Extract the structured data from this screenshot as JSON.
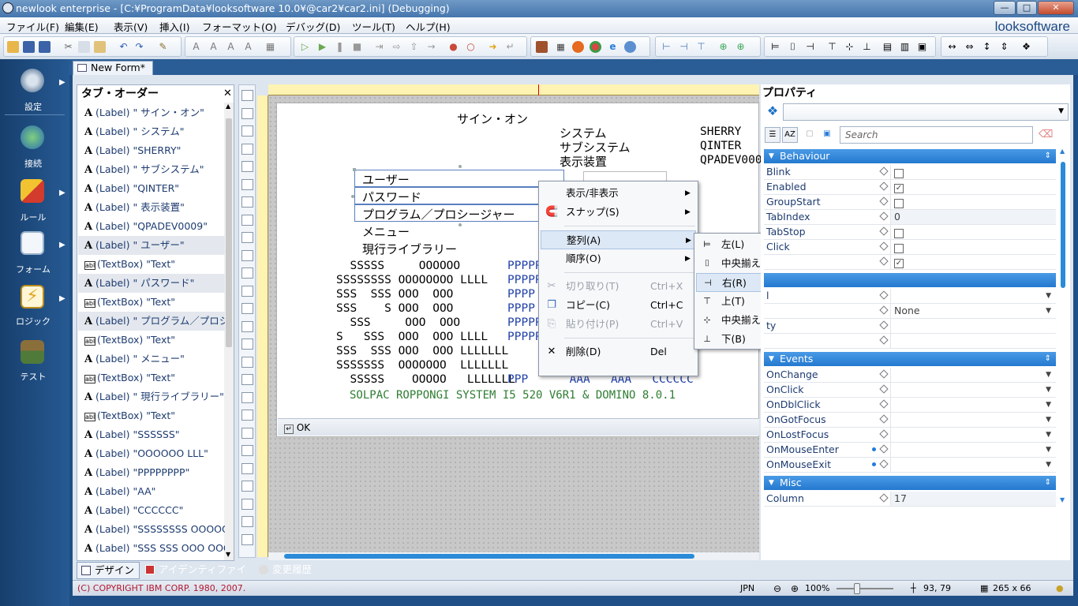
{
  "window": {
    "title": "newlook enterprise - [C:¥ProgramData¥looksoftware 10.0¥@car2¥car2.ini] (Debugging)",
    "brand": "looksoftware"
  },
  "menu": [
    "ファイル(F)",
    "編集(E)",
    "表示(V)",
    "挿入(I)",
    "フォーマット(O)",
    "デバッグ(D)",
    "ツール(T)",
    "ヘルプ(H)"
  ],
  "nav": [
    {
      "label": "設定",
      "icon": "gear-icon"
    },
    {
      "label": "接続",
      "icon": "globe-icon"
    },
    {
      "label": "ルール",
      "icon": "blocks-icon"
    },
    {
      "label": "フォーム",
      "icon": "form-icon"
    },
    {
      "label": "ロジック",
      "icon": "lightning-icon"
    },
    {
      "label": "テスト",
      "icon": "stamp-icon"
    }
  ],
  "doc_tab": "New Form*",
  "taborder": {
    "title": "タブ・オーダー",
    "items": [
      {
        "type": "A",
        "text": "(Label) \"        サイン・オン\""
      },
      {
        "type": "A",
        "text": "(Label) \" システム\""
      },
      {
        "type": "A",
        "text": "(Label) \"SHERRY\""
      },
      {
        "type": "A",
        "text": "(Label) \" サブシステム\""
      },
      {
        "type": "A",
        "text": "(Label) \"QINTER\""
      },
      {
        "type": "A",
        "text": "(Label) \" 表示装置\""
      },
      {
        "type": "A",
        "text": "(Label) \"QPADEV0009\""
      },
      {
        "type": "A",
        "text": "(Label) \" ユーザー\"",
        "hl": true
      },
      {
        "type": "abl",
        "text": "(TextBox) \"Text\""
      },
      {
        "type": "A",
        "text": "(Label) \" パスワード\"",
        "hl": true
      },
      {
        "type": "abl",
        "text": "(TextBox) \"Text\""
      },
      {
        "type": "A",
        "text": "(Label) \" プログラム／プロシージャー\"",
        "hl": true
      },
      {
        "type": "abl",
        "text": "(TextBox) \"Text\""
      },
      {
        "type": "A",
        "text": "(Label) \" メニュー\""
      },
      {
        "type": "abl",
        "text": "(TextBox) \"Text\""
      },
      {
        "type": "A",
        "text": "(Label) \" 現行ライブラリー\""
      },
      {
        "type": "abl",
        "text": "(TextBox) \"Text\""
      },
      {
        "type": "A",
        "text": "(Label) \"SSSSSS\""
      },
      {
        "type": "A",
        "text": "(Label) \"OOOOOO  LLL\""
      },
      {
        "type": "A",
        "text": "(Label) \"PPPPPPPP\""
      },
      {
        "type": "A",
        "text": "(Label) \"AA\""
      },
      {
        "type": "A",
        "text": "(Label) \"CCCCCC\""
      },
      {
        "type": "A",
        "text": "(Label) \"SSSSSSSS OOOOOOOO\""
      },
      {
        "type": "A",
        "text": "(Label) \"SSS  SSS OOO  OOO\""
      }
    ]
  },
  "form": {
    "title": "サイン・オン",
    "sys_labels": [
      "システム",
      "サブシステム",
      "表示装置"
    ],
    "sys_values": [
      "SHERRY",
      "QINTER",
      "QPADEV000"
    ],
    "fields": [
      "ユーザー",
      "パスワード",
      "プログラム／プロシージャー",
      "メニュー",
      "現行ライブラリー"
    ],
    "art_black": [
      "  SSSSS     OOOOOO",
      "SSSSSSSS OOOOOOOO LLLL",
      "SSS  SSS OOO  OOO",
      "SSS    S OOO  OOO",
      "  SSS     OOO  OOO",
      "S   SSS  OOO  OOO LLLL",
      "SSS  SSS OOO  OOO LLLLLLL",
      "SSSSSSS  OOOOOOO  LLLLLLL",
      "  SSSSS    OOOOO   LLLLLLL"
    ],
    "art_blue": [
      "PPPPP",
      "PPPPP",
      "PPPP",
      "PPPP",
      "PPPPP",
      "PPPPP",
      "",
      "",
      "PPP      AAA   AAA   CCCCCC"
    ],
    "footer": "SOLPAC ROPPONGI SYSTEM I5 520 V6R1 & DOMINO 8.0.1",
    "ok": "OK"
  },
  "context_menu": [
    {
      "label": "表示/非表示",
      "arrow": true
    },
    {
      "label": "スナップ(S)",
      "arrow": true,
      "icon": "snap-icon"
    },
    {
      "sep": true
    },
    {
      "label": "整列(A)",
      "arrow": true,
      "hl": true
    },
    {
      "label": "順序(O)",
      "arrow": true
    },
    {
      "sep": true
    },
    {
      "label": "切り取り(T)",
      "shortcut": "Ctrl+X",
      "disabled": true,
      "icon": "cut-icon"
    },
    {
      "label": "コピー(C)",
      "shortcut": "Ctrl+C",
      "icon": "copy-icon"
    },
    {
      "label": "貼り付け(P)",
      "shortcut": "Ctrl+V",
      "disabled": true,
      "icon": "paste-icon"
    },
    {
      "sep": true
    },
    {
      "label": "削除(D)",
      "shortcut": "Del",
      "icon": "delete-icon"
    }
  ],
  "align_submenu": [
    {
      "label": "左(L)",
      "icon": "align-left-icon"
    },
    {
      "label": "中央揃え(C)",
      "icon": "align-center-icon"
    },
    {
      "label": "右(R)",
      "icon": "align-right-icon",
      "hl": true
    },
    {
      "label": "上(T)",
      "icon": "align-top-icon"
    },
    {
      "label": "中央揃え(M)",
      "icon": "align-middle-icon"
    },
    {
      "label": "下(B)",
      "icon": "align-bottom-icon"
    }
  ],
  "properties": {
    "title": "プロパティ",
    "search_placeholder": "Search",
    "behaviour_title": "Behaviour",
    "behaviour": [
      {
        "name": "Blink",
        "cb": false
      },
      {
        "name": "Enabled",
        "cb": true
      },
      {
        "name": "GroupStart",
        "cb": false
      },
      {
        "name": "TabIndex",
        "value": "0"
      },
      {
        "name": "TabStop",
        "cb": false
      },
      {
        "name": "Click",
        "cb": false
      },
      {
        "name": "",
        "cb": true
      }
    ],
    "mid_rows": [
      {
        "name": "l",
        "value": "",
        "dd": true
      },
      {
        "name": "",
        "value": "None",
        "dd": true
      },
      {
        "name": "ty",
        "value": "",
        "dd": false
      },
      {
        "name": "",
        "value": "",
        "dd": false
      }
    ],
    "events_title": "Events",
    "events": [
      "OnChange",
      "OnClick",
      "OnDblClick",
      "OnGotFocus",
      "OnLostFocus",
      "OnMouseEnter",
      "OnMouseExit"
    ],
    "misc_title": "Misc",
    "misc": [
      {
        "name": "Column",
        "value": "17"
      }
    ]
  },
  "bottom_tabs": [
    "デザイン",
    "アイデンティファイ",
    "変更履歴"
  ],
  "status": {
    "copyright": "(C) COPYRIGHT IBM CORP. 1980, 2007.",
    "lang": "JPN",
    "zoom": "100%",
    "pos": "93, 79",
    "size": "265 x 66"
  }
}
